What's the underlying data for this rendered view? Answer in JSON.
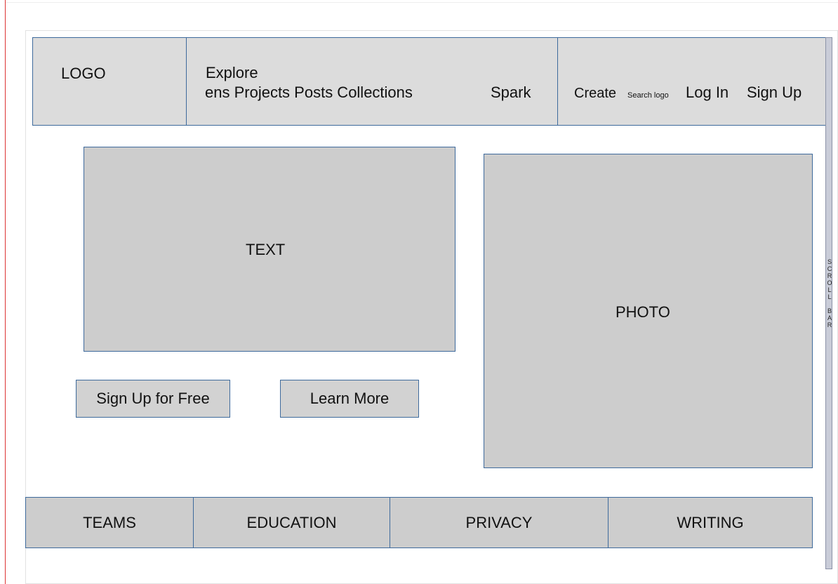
{
  "header": {
    "logo": "LOGO",
    "nav_explore": "Explore",
    "nav_links": "ens Projects Posts Collections",
    "nav_spark": "Spark",
    "create": "Create",
    "search_logo": "Search logo",
    "login": "Log In",
    "signup": "Sign Up"
  },
  "main": {
    "text_placeholder": "TEXT",
    "photo_placeholder": "PHOTO",
    "signup_free_button": "Sign Up for Free",
    "learn_more_button": "Learn More"
  },
  "footer": {
    "items": [
      "TEAMS",
      "EDUCATION",
      "PRIVACY",
      "WRITING"
    ]
  },
  "scrollbar": {
    "letters": [
      "S",
      "C",
      "R",
      "O",
      "L",
      "L",
      "",
      "B",
      "A",
      "R"
    ]
  }
}
